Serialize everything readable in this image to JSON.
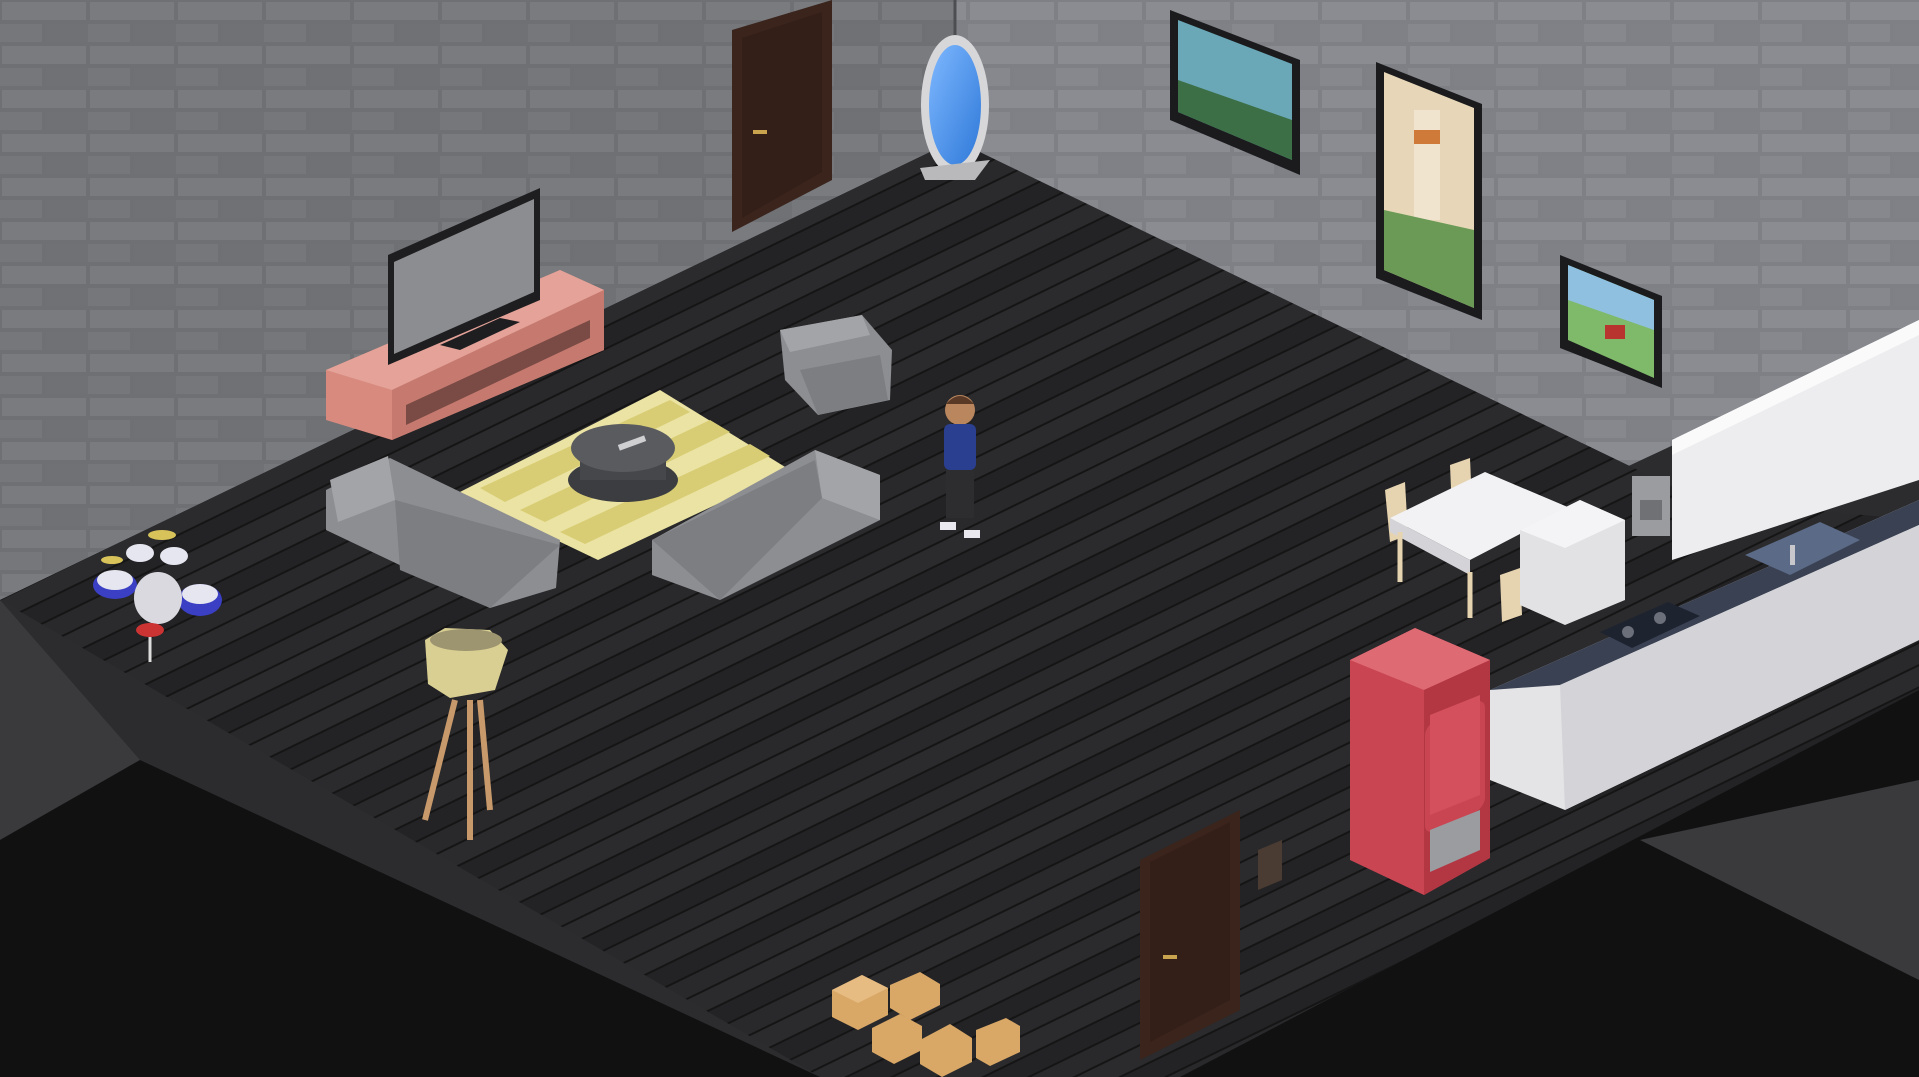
{
  "scene": {
    "kind": "isometric-room",
    "walls": {
      "color": "#7d7f84",
      "mortar": "#5a5c60",
      "style": "brick"
    },
    "floor": {
      "color": "#242426",
      "plank_line": "#151516",
      "style": "dark-wood-planks"
    },
    "void_color": "#2c2c2e"
  },
  "objects": [
    {
      "name": "back-door",
      "icon": "door-icon",
      "color": "#3a241c",
      "interactable": true
    },
    {
      "name": "oval-mirror",
      "icon": "mirror-icon",
      "color": "#3f8fe0",
      "interactable": true
    },
    {
      "name": "painting-coast",
      "icon": "painting-icon",
      "color": "#5b8fa0",
      "interactable": true
    },
    {
      "name": "painting-lighthouse",
      "icon": "painting-icon",
      "color": "#d9c7a6",
      "interactable": true
    },
    {
      "name": "painting-red-barn",
      "icon": "painting-icon",
      "color": "#3f7f43",
      "interactable": true
    },
    {
      "name": "television",
      "icon": "tv-icon",
      "color": "#8c8d90",
      "interactable": true
    },
    {
      "name": "tv-stand",
      "icon": "cabinet-icon",
      "color": "#d88a7f",
      "interactable": true
    },
    {
      "name": "armchair",
      "icon": "armchair-icon",
      "color": "#8d8e92",
      "interactable": true
    },
    {
      "name": "striped-rug",
      "icon": "rug-icon",
      "color": "#e3da8c",
      "interactable": false
    },
    {
      "name": "coffee-table",
      "icon": "table-icon",
      "color": "#4f5053",
      "interactable": true
    },
    {
      "name": "sofa-left",
      "icon": "sofa-icon",
      "color": "#8d8e92",
      "interactable": true
    },
    {
      "name": "sofa-right",
      "icon": "sofa-icon",
      "color": "#8d8e92",
      "interactable": true
    },
    {
      "name": "player-character",
      "icon": "person-icon",
      "color": "#2a3f8f",
      "interactable": true
    },
    {
      "name": "drum-kit",
      "icon": "drum-icon",
      "color": "#3a3fc4",
      "interactable": true
    },
    {
      "name": "floor-lamp",
      "icon": "lamp-icon",
      "color": "#d9cf93",
      "interactable": true
    },
    {
      "name": "dining-table",
      "icon": "table-icon",
      "color": "#f2f2f4",
      "interactable": true
    },
    {
      "name": "dining-chairs",
      "icon": "chair-icon",
      "color": "#e6d3b0",
      "interactable": true
    },
    {
      "name": "kitchen-counter",
      "icon": "counter-icon",
      "color": "#e4e4e6",
      "interactable": true
    },
    {
      "name": "upper-cabinets",
      "icon": "cabinet-icon",
      "color": "#ededef",
      "interactable": true
    },
    {
      "name": "microwave",
      "icon": "microwave-icon",
      "color": "#e2e2e4",
      "interactable": true
    },
    {
      "name": "coffee-maker",
      "icon": "coffee-maker-icon",
      "color": "#9a9ca0",
      "interactable": true
    },
    {
      "name": "kitchen-sink",
      "icon": "sink-icon",
      "color": "#40506a",
      "interactable": true
    },
    {
      "name": "stove-top",
      "icon": "stove-icon",
      "color": "#2c3345",
      "interactable": true
    },
    {
      "name": "red-refrigerator",
      "icon": "fridge-icon",
      "color": "#c94552",
      "interactable": true
    },
    {
      "name": "front-door",
      "icon": "door-icon",
      "color": "#3a241c",
      "interactable": true
    },
    {
      "name": "light-switch",
      "icon": "switch-icon",
      "color": "#4a3c32",
      "interactable": true
    },
    {
      "name": "cardboard-boxes",
      "icon": "box-icon",
      "color": "#d9a766",
      "interactable": true
    }
  ]
}
